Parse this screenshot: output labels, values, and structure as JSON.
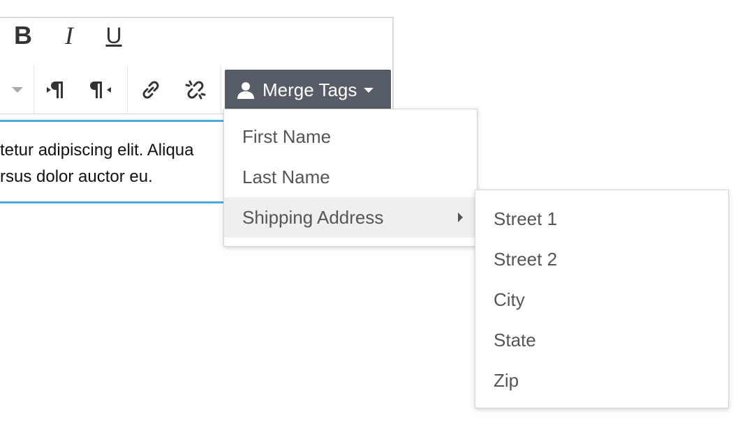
{
  "toolbar": {
    "bold_label": "B",
    "italic_label": "I",
    "underline_label": "U",
    "merge_tags_label": "Merge Tags"
  },
  "editor": {
    "lines": [
      "tetur adipiscing elit. Aliqua",
      "rsus dolor auctor eu."
    ]
  },
  "merge_menu": {
    "items": [
      {
        "label": "First Name"
      },
      {
        "label": "Last Name"
      },
      {
        "label": "Shipping Address"
      }
    ]
  },
  "shipping_submenu": {
    "items": [
      {
        "label": "Street 1"
      },
      {
        "label": "Street 2"
      },
      {
        "label": "City"
      },
      {
        "label": "State"
      },
      {
        "label": "Zip"
      }
    ]
  },
  "colors": {
    "merge_button_bg": "#565d66",
    "editor_focus_border": "#4aa9e0",
    "active_menu_bg": "#efefef"
  }
}
